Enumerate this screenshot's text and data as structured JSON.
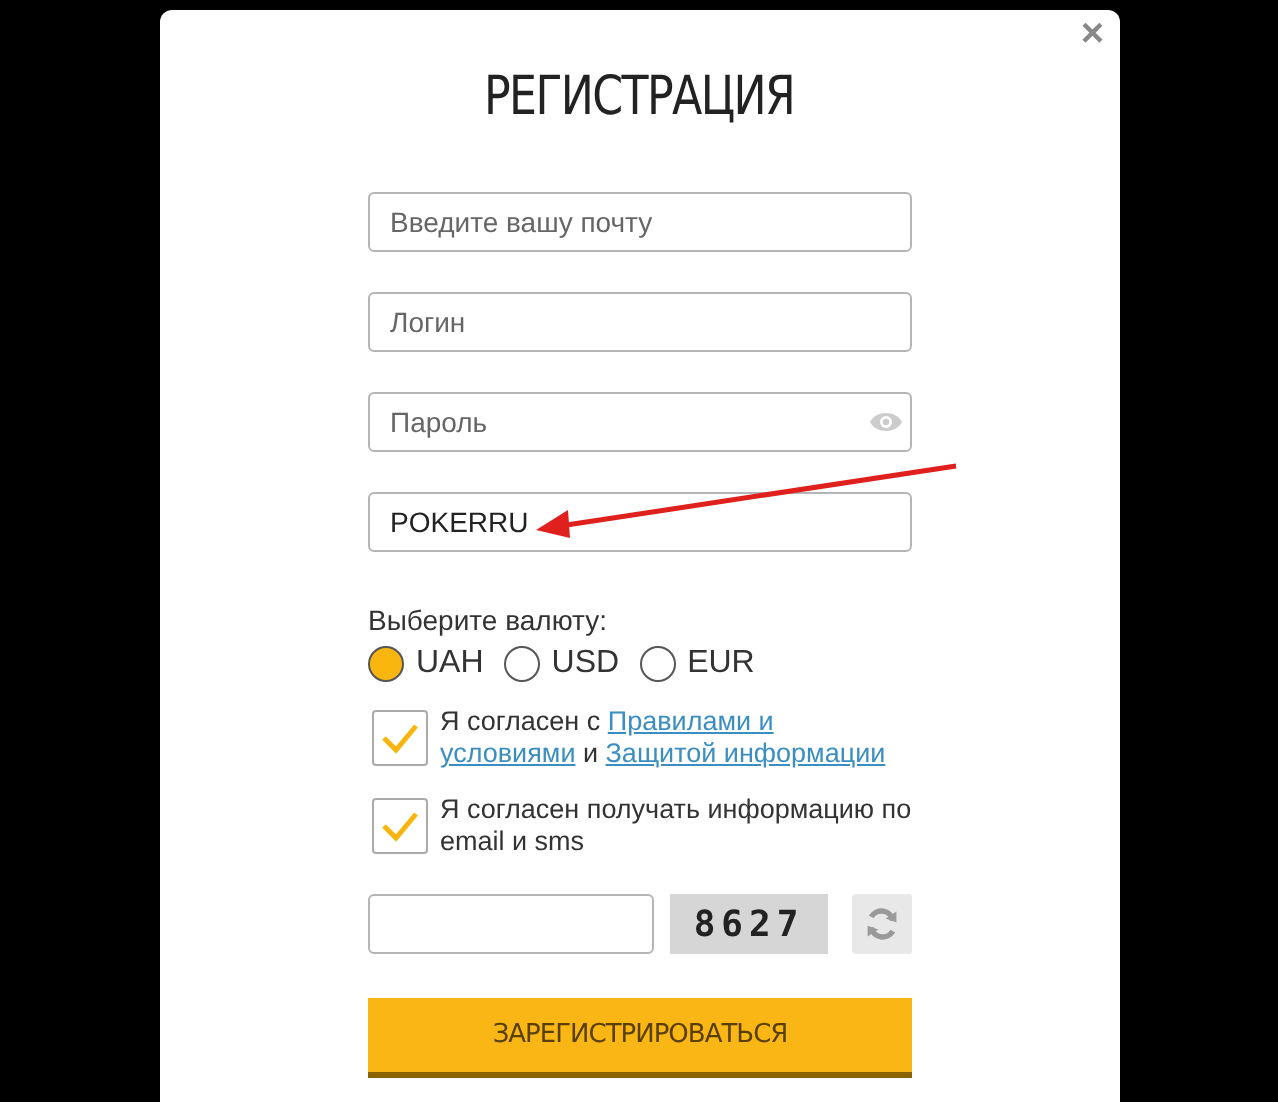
{
  "dialog": {
    "title": "РЕГИСТРАЦИЯ",
    "close": "×"
  },
  "fields": [
    {
      "kind": "text",
      "placeholder": "Введите вашу почту"
    },
    {
      "kind": "text",
      "placeholder": "Логин"
    },
    {
      "kind": "password",
      "placeholder": "Пароль"
    },
    {
      "kind": "text",
      "value": "POKERRU"
    }
  ],
  "currency": {
    "label": "Выберите валюту:",
    "options": [
      {
        "label": "UAH",
        "selected": true
      },
      {
        "label": "USD",
        "selected": false
      },
      {
        "label": "EUR",
        "selected": false
      }
    ]
  },
  "agreements": [
    {
      "checked": true,
      "text_before": "Я согласен с ",
      "link1": "Правилами и условиями",
      "text_middle": " и ",
      "link2": "Защитой информации"
    },
    {
      "checked": true,
      "text_before": "Я согласен получать информацию по email и sms"
    }
  ],
  "captcha": {
    "code": "8627"
  },
  "submit": "ЗАРЕГИСТРИРОВАТЬСЯ"
}
